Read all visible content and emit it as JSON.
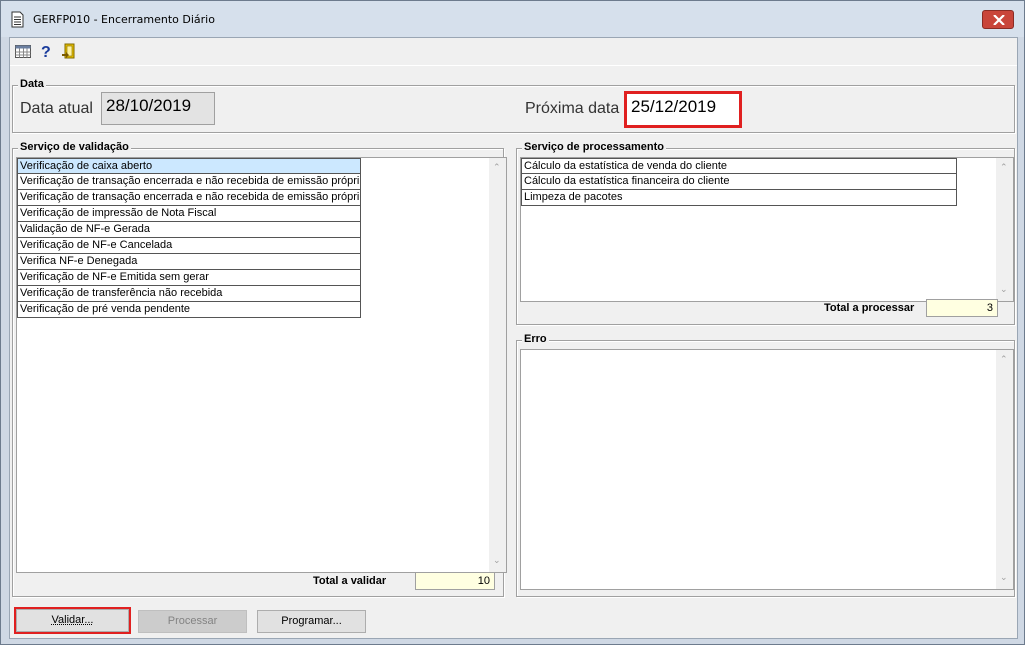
{
  "window": {
    "title": "GERFP010 - Encerramento Diário"
  },
  "toolbar": {
    "icons": [
      "calendar-grid-icon",
      "help-icon",
      "exit-door-icon"
    ]
  },
  "data_group": {
    "label": "Data",
    "current_label": "Data atual",
    "current_value": "28/10/2019",
    "next_label": "Próxima data",
    "next_value": "25/12/2019"
  },
  "validation": {
    "label": "Serviço de validação",
    "items": [
      "Verificação de caixa aberto",
      "Verificação de transação encerrada e não recebida de emissão própri",
      "Verificação de transação encerrada e não recebida de emissão própri",
      "Verificação de impressão de Nota Fiscal",
      "Validação de NF-e Gerada",
      "Verificação de NF-e Cancelada",
      "Verifica NF-e Denegada",
      "Verificação de NF-e Emitida sem gerar",
      "Verificação de transferência não recebida",
      "Verificação de pré venda pendente"
    ],
    "total_label": "Total a validar",
    "total_value": "10"
  },
  "processing": {
    "label": "Serviço de processamento",
    "items": [
      "Cálculo da estatística de venda do cliente",
      "Cálculo da estatística financeira do cliente",
      "Limpeza de pacotes"
    ],
    "total_label": "Total a processar",
    "total_value": "3"
  },
  "error": {
    "label": "Erro"
  },
  "buttons": {
    "validar": "Validar...",
    "processar": "Processar",
    "programar": "Programar..."
  },
  "colors": {
    "highlight": "#e02020",
    "selected_row": "#cce8ff",
    "total_bg": "#ffffe1"
  }
}
